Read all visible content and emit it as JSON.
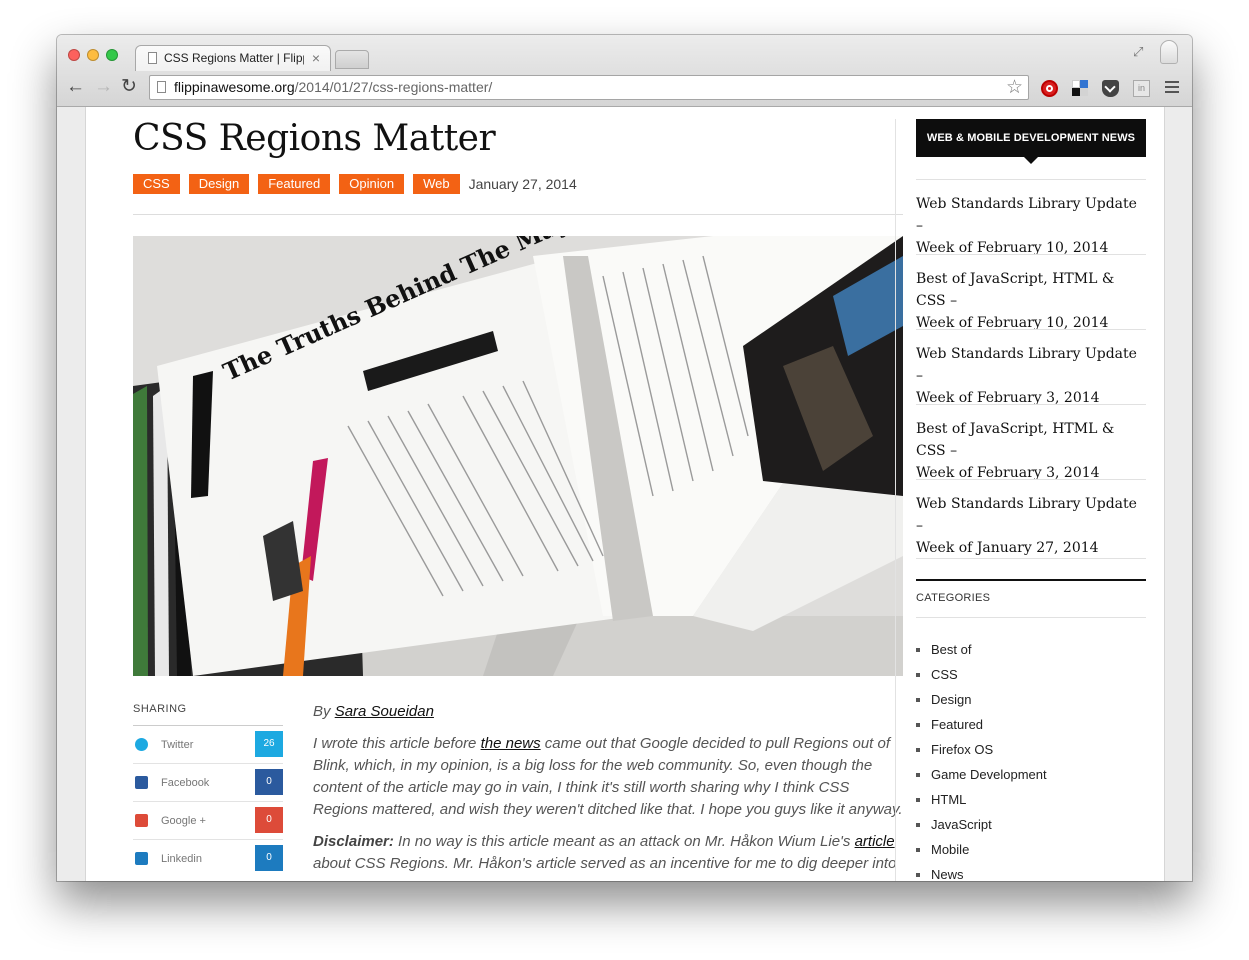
{
  "browser": {
    "tab_title": "CSS Regions Matter | Flippin",
    "url_host": "flippinawesome.org",
    "url_path": "/2014/01/27/css-regions-matter/"
  },
  "article": {
    "title": "CSS Regions Matter",
    "tags": [
      "CSS",
      "Design",
      "Featured",
      "Opinion",
      "Web"
    ],
    "date": "January 27, 2014",
    "byline_prefix": "By",
    "author": "Sara Soueidan",
    "intro_1": "I wrote this article before",
    "intro_link": "the news",
    "intro_2": "came out that Google decided to pull Regions out of Blink, which, in my opinion, is a big loss for the web community. So, even though the content of the article may go in vain, I think it's still worth sharing why I think CSS Regions mattered, and wish they weren't ditched like that. I hope you guys like it anyway.",
    "disclaimer_label": "Disclaimer:",
    "disclaimer_1": "In no way is this article meant as an attack on Mr. Håkon Wium Lie's",
    "disclaimer_link": "article",
    "disclaimer_2": "about CSS Regions. Mr. Håkon's article served as an incentive for me to dig deeper into"
  },
  "hero_image": {
    "headline": "The Truths Behind The Mayhem"
  },
  "sharing": {
    "heading": "SHARING",
    "items": [
      {
        "label": "Twitter",
        "count": "26",
        "color": "#1da9e1"
      },
      {
        "label": "Facebook",
        "count": "0",
        "color": "#2b5a9e"
      },
      {
        "label": "Google +",
        "count": "0",
        "color": "#dd4b39"
      },
      {
        "label": "Linkedin",
        "count": "0",
        "color": "#1d7bbf"
      }
    ]
  },
  "sidebar": {
    "heading": "WEB & MOBILE DEVELOPMENT NEWS",
    "news": [
      {
        "line1": "Web Standards Library Update –",
        "line2": "Week of February 10, 2014"
      },
      {
        "line1": "Best of JavaScript, HTML & CSS –",
        "line2": "Week of February 10, 2014"
      },
      {
        "line1": "Web Standards Library Update –",
        "line2": "Week of February 3, 2014"
      },
      {
        "line1": "Best of JavaScript, HTML & CSS –",
        "line2": "Week of February 3, 2014"
      },
      {
        "line1": "Web Standards Library Update –",
        "line2": "Week of January 27, 2014"
      }
    ],
    "categories_heading": "CATEGORIES",
    "categories": [
      "Best of",
      "CSS",
      "Design",
      "Featured",
      "Firefox OS",
      "Game Development",
      "HTML",
      "JavaScript",
      "Mobile",
      "News"
    ]
  },
  "colors": {
    "tag_accent": "#f36214",
    "sidebar_heading_bg": "#0d0d0d"
  }
}
